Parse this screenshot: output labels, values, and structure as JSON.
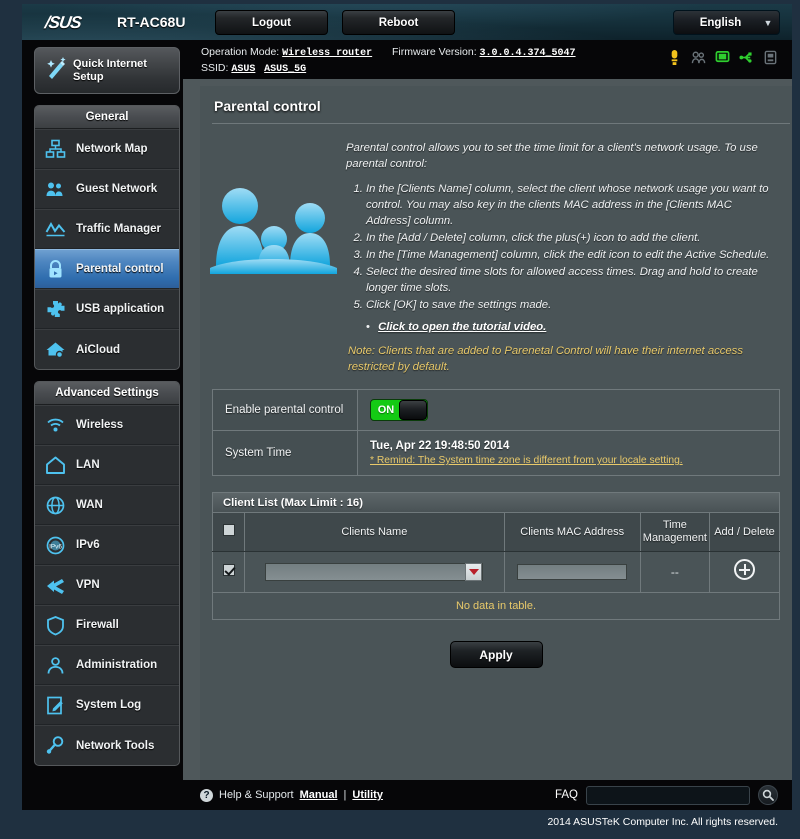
{
  "header": {
    "brand": "/SUS",
    "model": "RT-AC68U",
    "logout_label": "Logout",
    "reboot_label": "Reboot",
    "language": "English",
    "operation_mode_label": "Operation Mode:",
    "operation_mode_value": "Wireless router",
    "firmware_label": "Firmware Version:",
    "firmware_value": "3.0.0.4.374_5047",
    "ssid_label": "SSID:",
    "ssid_1": "ASUS",
    "ssid_2": "ASUS_5G",
    "status_icons": [
      {
        "name": "warning-icon",
        "color": "#f2c21c"
      },
      {
        "name": "clients-icon",
        "color": "#6a7379"
      },
      {
        "name": "monitor-icon",
        "color": "#2fcf2f"
      },
      {
        "name": "usb-icon",
        "color": "#2fcf2f"
      },
      {
        "name": "printer-icon",
        "color": "#6a7379"
      }
    ]
  },
  "sidebar": {
    "quick_setup_label": "Quick Internet Setup",
    "groups": [
      {
        "title": "General",
        "items": [
          {
            "label": "Network Map",
            "icon": "network-map-icon",
            "active": false
          },
          {
            "label": "Guest Network",
            "icon": "guest-network-icon",
            "active": false
          },
          {
            "label": "Traffic Manager",
            "icon": "traffic-manager-icon",
            "active": false
          },
          {
            "label": "Parental control",
            "icon": "parental-control-icon",
            "active": true
          },
          {
            "label": "USB application",
            "icon": "usb-application-icon",
            "active": false
          },
          {
            "label": "AiCloud",
            "icon": "aicloud-icon",
            "active": false
          }
        ]
      },
      {
        "title": "Advanced Settings",
        "items": [
          {
            "label": "Wireless",
            "icon": "wireless-icon",
            "active": false
          },
          {
            "label": "LAN",
            "icon": "lan-icon",
            "active": false
          },
          {
            "label": "WAN",
            "icon": "wan-icon",
            "active": false
          },
          {
            "label": "IPv6",
            "icon": "ipv6-icon",
            "active": false
          },
          {
            "label": "VPN",
            "icon": "vpn-icon",
            "active": false
          },
          {
            "label": "Firewall",
            "icon": "firewall-icon",
            "active": false
          },
          {
            "label": "Administration",
            "icon": "administration-icon",
            "active": false
          },
          {
            "label": "System Log",
            "icon": "system-log-icon",
            "active": false
          },
          {
            "label": "Network Tools",
            "icon": "network-tools-icon",
            "active": false
          }
        ]
      }
    ]
  },
  "main": {
    "page_title": "Parental control",
    "intro_lead": "Parental control allows you to set the time limit for a client's network usage. To use parental control:",
    "steps": [
      "In the [Clients Name] column, select the client whose network usage you want to control. You may also key in the clients MAC address in the [Clients MAC Address] column.",
      "In the [Add / Delete] column, click the plus(+) icon to add the client.",
      "In the [Time Management] column, click the edit icon to edit the Active Schedule.",
      "Select the desired time slots for allowed access times. Drag and hold to create longer time slots.",
      "Click [OK] to save the settings made."
    ],
    "tutorial_link": "Click to open the tutorial video.",
    "note": "Note: Clients that are added to Parenetal Control will have their internet access restricted by default.",
    "settings": {
      "enable_label": "Enable parental control",
      "toggle_state": "ON",
      "system_time_label": "System Time",
      "system_time_value": "Tue, Apr 22 19:48:50 2014",
      "system_time_remind": "* Remind: The System time zone is different from your locale setting."
    },
    "client_list": {
      "header": "Client List (Max Limit : 16)",
      "columns": [
        "",
        "Clients Name",
        "Clients MAC Address",
        "Time Management",
        "Add / Delete"
      ],
      "col_time_line1": "Time",
      "col_time_line2": "Management",
      "row": {
        "checked": true,
        "name_value": "",
        "mac_value": "",
        "time_management": "--",
        "add_icon": "plus-circle-icon"
      },
      "empty_message": "No data in table."
    },
    "apply_label": "Apply"
  },
  "footer": {
    "help_label": "Help & Support",
    "manual_label": "Manual",
    "separator": "|",
    "utility_label": "Utility",
    "faq_label": "FAQ",
    "faq_value": "",
    "faq_placeholder": "",
    "copyright": "2014 ASUSTeK Computer Inc. All rights reserved."
  },
  "colors": {
    "accent_blue": "#2f6dae",
    "toggle_green": "#14ca14",
    "note_yellow": "#e8c96a",
    "panel_gray": "#4a5457"
  }
}
